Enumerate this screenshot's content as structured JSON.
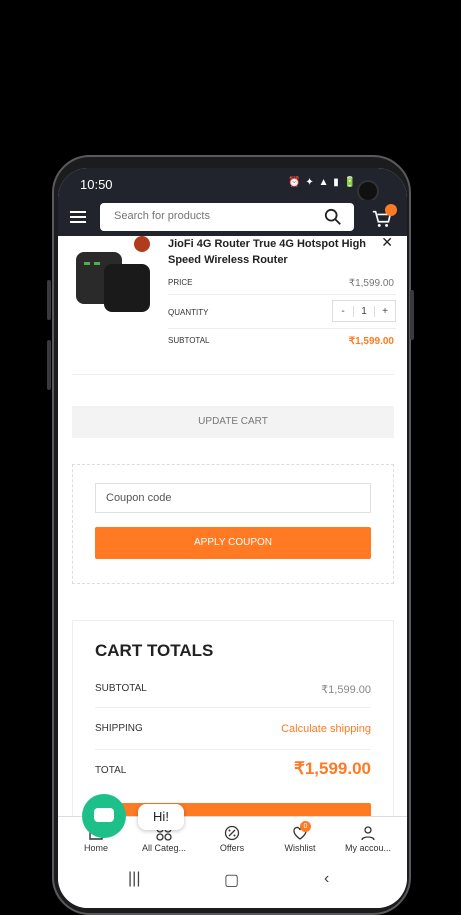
{
  "status": {
    "time": "10:50",
    "icons": "⏰ ✦ ▲ ▮ 🔋"
  },
  "header": {
    "search_placeholder": "Search for products",
    "cart_count": ""
  },
  "product": {
    "title": "JioFi 4G Router True 4G Hotspot High Speed Wireless Router",
    "price_label": "PRICE",
    "price": "₹1,599.00",
    "quantity_label": "QUANTITY",
    "quantity": "1",
    "subtotal_label": "SUBTOTAL",
    "subtotal": "₹1,599.00"
  },
  "actions": {
    "update_cart": "UPDATE CART"
  },
  "coupon": {
    "placeholder": "Coupon code",
    "apply_label": "APPLY COUPON"
  },
  "totals": {
    "title": "CART TOTALS",
    "subtotal_label": "SUBTOTAL",
    "subtotal": "₹1,599.00",
    "shipping_label": "SHIPPING",
    "shipping_link": "Calculate shipping",
    "total_label": "TOTAL",
    "total": "₹1,599.00"
  },
  "chat": {
    "greeting": "Hi!"
  },
  "nav": {
    "items": [
      {
        "label": "Home"
      },
      {
        "label": "All Categ..."
      },
      {
        "label": "Offers"
      },
      {
        "label": "Wishlist"
      },
      {
        "label": "My accou..."
      }
    ],
    "wishlist_count": "0"
  },
  "colors": {
    "accent": "#ff7a22",
    "header": "#22242d",
    "chat": "#1ec08a"
  }
}
